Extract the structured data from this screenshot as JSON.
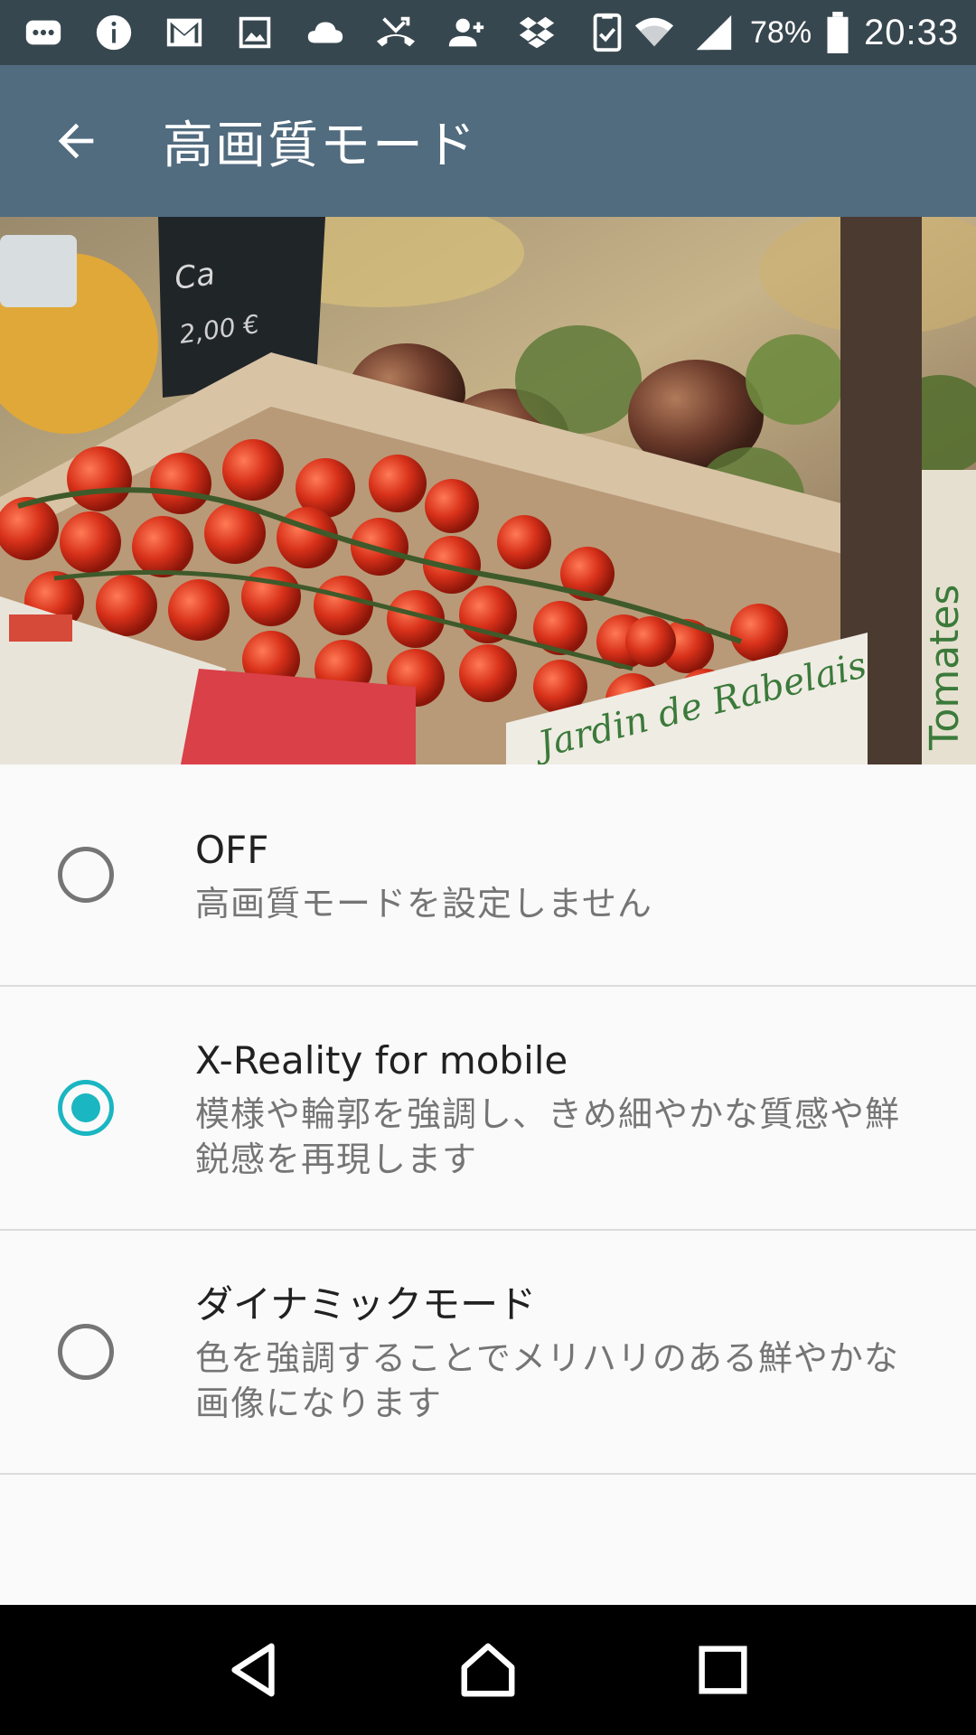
{
  "status_bar": {
    "battery_percent": "78%",
    "time": "20:33",
    "icons": [
      "chat-icon",
      "info-icon",
      "gmail-icon",
      "image-icon",
      "cloud-icon",
      "missed-call-icon",
      "add-person-icon",
      "dropbox-icon",
      "clipboard-check-icon",
      "wifi-icon",
      "signal-icon",
      "battery-icon"
    ]
  },
  "app_bar": {
    "title": "高画質モード"
  },
  "options": [
    {
      "title": "OFF",
      "subtitle": "高画質モードを設定しません",
      "selected": false
    },
    {
      "title": "X-Reality for mobile",
      "subtitle": "模様や輪郭を強調し、きめ細やかな質感や鮮鋭感を再現します",
      "selected": true
    },
    {
      "title": "ダイナミックモード",
      "subtitle": "色を強調することでメリハリのある鮮やかな画像になります",
      "selected": false
    }
  ],
  "colors": {
    "status_bar": "#37474f",
    "app_bar": "#516b7f",
    "accent": "#1ab6c1",
    "background": "#fafafa"
  }
}
